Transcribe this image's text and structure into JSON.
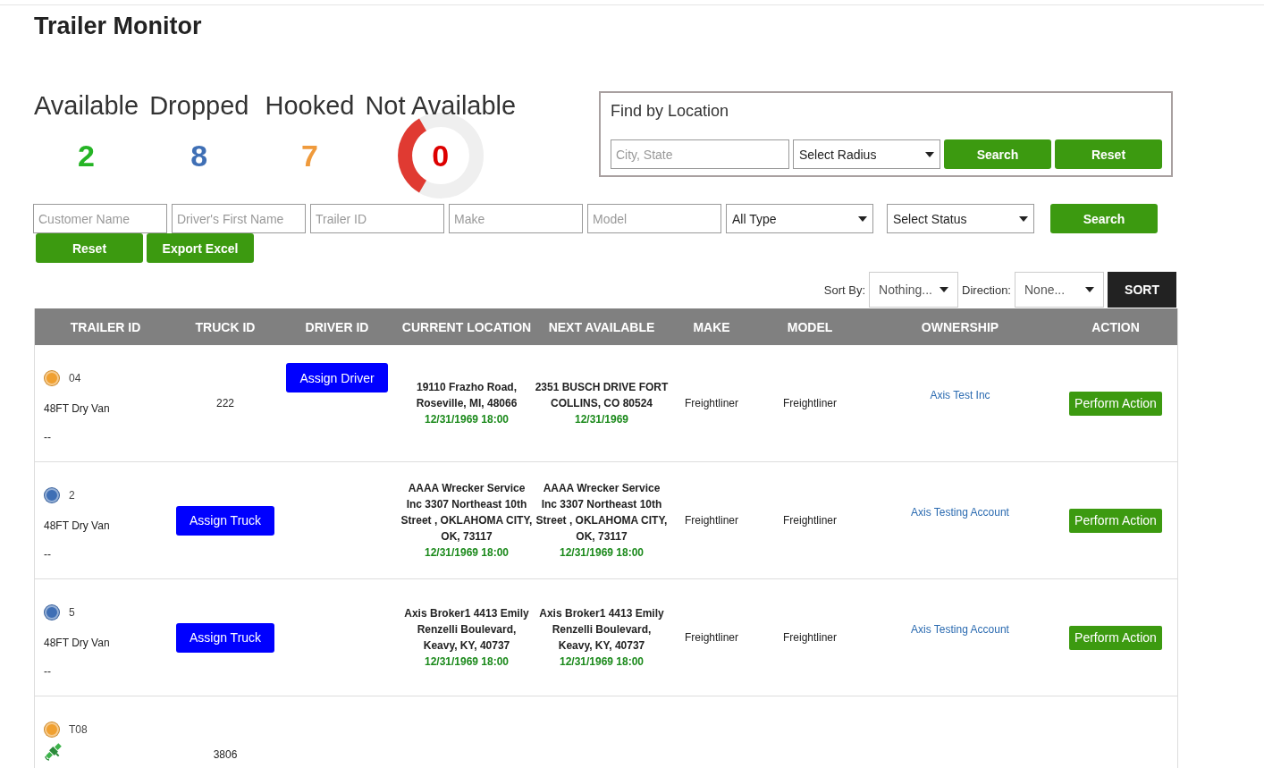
{
  "page": {
    "title": "Trailer Monitor"
  },
  "stats": [
    {
      "label": "Available",
      "value": "2",
      "color": "#25b425",
      "kind": "plain"
    },
    {
      "label": "Dropped",
      "value": "8",
      "color": "#3f6fb5",
      "kind": "plain"
    },
    {
      "label": "Hooked",
      "value": "7",
      "color": "#ef9a3c",
      "kind": "plain"
    },
    {
      "label": "Not Available",
      "value": "0",
      "color": "#dd0000",
      "kind": "gauge"
    }
  ],
  "location_search": {
    "title": "Find by Location",
    "city_field": {
      "placeholder": "City, State"
    },
    "radius_select": {
      "value": "Select Radius"
    },
    "buttons": [
      "Search",
      "Reset"
    ]
  },
  "filters": {
    "fields": [
      {
        "kind": "input",
        "placeholder": "Customer Name"
      },
      {
        "kind": "input",
        "placeholder": "Driver's First Name"
      },
      {
        "kind": "input",
        "placeholder": "Trailer ID"
      },
      {
        "kind": "input",
        "placeholder": "Make"
      },
      {
        "kind": "input",
        "placeholder": "Model"
      },
      {
        "kind": "select",
        "value": "All Type"
      },
      {
        "kind": "select",
        "value": "Select Status"
      }
    ],
    "search_button": "Search",
    "buttons": [
      "Reset",
      "Export Excel"
    ]
  },
  "sort": {
    "sort_by_label": "Sort By:",
    "sort_by_value": "Nothing...",
    "direction_label": "Direction:",
    "direction_value": "None...",
    "button": "SORT"
  },
  "table": {
    "columns": [
      "TRAILER ID",
      "TRUCK ID",
      "DRIVER ID",
      "CURRENT LOCATION",
      "NEXT AVAILABLE",
      "MAKE",
      "MODEL",
      "OWNERSHIP",
      "ACTION"
    ],
    "rows": [
      {
        "trailer_id": "04",
        "color": "#f0a030",
        "gps": false,
        "trailer_type": "48FT Dry Van",
        "note": "--",
        "truck": {
          "kind": "text",
          "text": "222"
        },
        "driver": {
          "kind": "button",
          "text": "Assign Driver"
        },
        "current_location": {
          "address": "19110 Frazho Road, Roseville, MI, 48066",
          "time": "12/31/1969 18:00"
        },
        "next_available": {
          "address": "2351 BUSCH DRIVE FORT COLLINS, CO 80524",
          "time": "12/31/1969"
        },
        "make": "Freightliner",
        "model": "Freightliner",
        "ownership": "Axis Test Inc",
        "action": "Perform Action"
      },
      {
        "trailer_id": "2",
        "color": "#3f6fb5",
        "gps": false,
        "trailer_type": "48FT Dry Van",
        "note": "--",
        "truck": {
          "kind": "button",
          "text": "Assign Truck"
        },
        "current_location": {
          "address": "AAAA Wrecker Service Inc 3307 Northeast 10th Street , OKLAHOMA CITY, OK, 73117",
          "time": "12/31/1969 18:00"
        },
        "next_available": {
          "address": "AAAA Wrecker Service Inc 3307 Northeast 10th Street , OKLAHOMA CITY, OK, 73117",
          "time": "12/31/1969 18:00"
        },
        "make": "Freightliner",
        "model": "Freightliner",
        "ownership": "Axis Testing Account",
        "action": "Perform Action"
      },
      {
        "trailer_id": "5",
        "color": "#3f6fb5",
        "gps": false,
        "trailer_type": "48FT Dry Van",
        "note": "--",
        "truck": {
          "kind": "button",
          "text": "Assign Truck"
        },
        "current_location": {
          "address": "Axis Broker1 4413 Emily Renzelli Boulevard, Keavy, KY, 40737",
          "time": "12/31/1969 18:00"
        },
        "next_available": {
          "address": "Axis Broker1 4413 Emily Renzelli Boulevard, Keavy, KY, 40737",
          "time": "12/31/1969 18:00"
        },
        "make": "Freightliner",
        "model": "Freightliner",
        "ownership": "Axis Testing Account",
        "action": "Perform Action"
      },
      {
        "trailer_id": "T08",
        "color": "#f0a030",
        "gps": true,
        "truck": {
          "kind": "text",
          "text": "3806"
        }
      }
    ]
  }
}
